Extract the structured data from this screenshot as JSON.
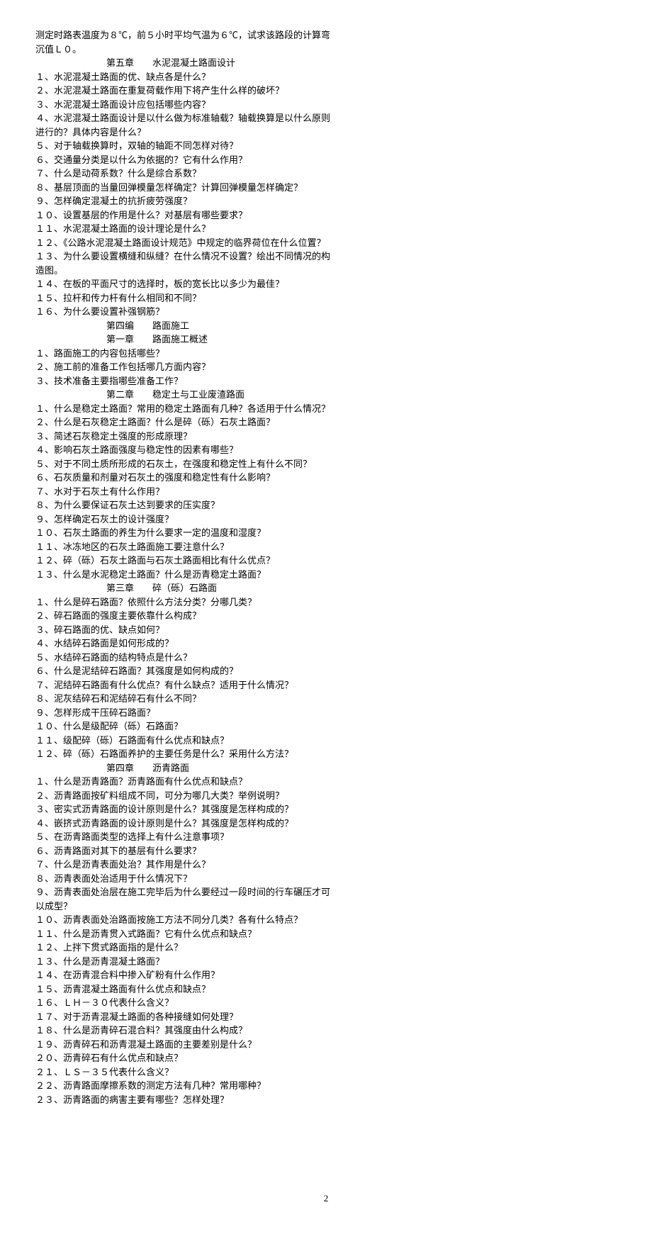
{
  "intro": "测定时路表温度为８℃，前５小时平均气温为６℃，试求该路段的计算弯沉值Ｌ０。",
  "ch5": {
    "title": "第五章　　水泥混凝土路面设计",
    "q1": "１、水泥混凝土路面的优、缺点各是什么？",
    "q2": "２、水泥混凝土路面在重复荷载作用下将产生什么样的破坏？",
    "q3": "３、水泥混凝土路面设计应包括哪些内容？",
    "q4": "４、水泥混凝土路面设计是以什么做为标准轴载？轴载换算是以什么原则进行的？具体内容是什么？",
    "q5": "５、对于轴载换算时，双轴的轴距不同怎样对待？",
    "q6": "６、交通量分类是以什么为依据的？它有什么作用？",
    "q7": "７、什么是动荷系数？什么是综合系数？",
    "q8": "８、基层顶面的当量回弹模量怎样确定？计算回弹模量怎样确定？",
    "q9": "９、怎样确定混凝土的抗折疲劳强度？",
    "q10": "１０、设置基层的作用是什么？对基层有哪些要求？",
    "q11": "１１、水泥混凝土路面的设计理论是什么？",
    "q12": "１２、《公路水泥混凝土路面设计规范》中规定的临界荷位在什么位置？",
    "q13": "１３、为什么要设置横缝和纵缝？在什么情况不设置？绘出不同情况的构造图。",
    "q14": "１４、在板的平面尺寸的选择时，板的宽长比以多少为最佳？",
    "q15": "１５、拉杆和传力杆有什么相同和不同？",
    "q16": "１６、为什么要设置补强钢筋？"
  },
  "part4": {
    "title": "第四编　　路面施工",
    "ch1": {
      "title": "第一章　　路面施工概述",
      "q1": "１、路面施工的内容包括哪些？",
      "q2": "２、施工前的准备工作包括哪几方面内容？",
      "q3": "３、技术准备主要指哪些准备工作？"
    },
    "ch2": {
      "title": "第二章　　稳定土与工业废渣路面",
      "q1": "１、什么是稳定土路面？常用的稳定土路面有几种？各适用于什么情况？",
      "q2": "２、什么是石灰稳定土路面？什么是碎（砾）石灰土路面？",
      "q3": "３、简述石灰稳定土强度的形成原理？",
      "q4": "４、影响石灰土路面强度与稳定性的因素有哪些？",
      "q5": "５、对于不同土质所形成的石灰土，在强度和稳定性上有什么不同？",
      "q6": "６、石灰质量和剂量对石灰土的强度和稳定性有什么影响？",
      "q7": "７、水对于石灰土有什么作用？",
      "q8": "８、为什么要保证石灰土达到要求的压实度？",
      "q9": "９、怎样确定石灰土的设计强度？",
      "q10": "１０、石灰土路面的养生为什么要求一定的温度和湿度？",
      "q11": "１１、冰冻地区的石灰土路面施工要注意什么？",
      "q12": "１２、碎（砾）石灰土路面与石灰土路面相比有什么优点？",
      "q13": "１３、什么是水泥稳定土路面？什么是沥青稳定土路面？"
    },
    "ch3": {
      "title": "第三章　　碎（砾）石路面",
      "q1": "１、什么是碎石路面？依照什么方法分类？分哪几类？",
      "q2": "２、碎石路面的强度主要依靠什么构成？",
      "q3": "３、碎石路面的优、缺点如何？",
      "q4": "４、水结碎石路面是如何形成的？",
      "q5": "５、水结碎石路面的结构特点是什么？",
      "q6": "６、什么是泥结碎石路面？其强度是如何构成的？",
      "q7": "７、泥结碎石路面有什么优点？有什么缺点？适用于什么情况？",
      "q8": "８、泥灰结碎石和泥结碎石有什么不同？",
      "q9": "９、怎样形成干压碎石路面？",
      "q10": "１０、什么是级配碎（砾）石路面？",
      "q11": "１１、级配碎（砾）石路面有什么优点和缺点？",
      "q12": "１２、碎（砾）石路面养护的主要任务是什么？采用什么方法？"
    },
    "ch4": {
      "title": "第四章　　沥青路面",
      "q1": "１、什么是沥青路面？沥青路面有什么优点和缺点？",
      "q2": "２、沥青路面按矿料组成不同，可分为哪几大类？举例说明？",
      "q3": "３、密实式沥青路面的设计原则是什么？其强度是怎样构成的？",
      "q4": "４、嵌挤式沥青路面的设计原则是什么？其强度是怎样构成的？",
      "q5": "５、在沥青路面类型的选择上有什么注意事项？",
      "q6": "６、沥青路面对其下的基层有什么要求？",
      "q7": "７、什么是沥青表面处治？其作用是什么？",
      "q8": "８、沥青表面处治适用于什么情况下？",
      "q9": "９、沥青表面处治层在施工完毕后为什么要经过一段时间的行车碾压才可以成型？",
      "q10": "１０、沥青表面处治路面按施工方法不同分几类？各有什么特点？",
      "q11": "１１、什么是沥青贯入式路面？它有什么优点和缺点？",
      "q12": "１２、上拌下贯式路面指的是什么？",
      "q13": "１３、什么是沥青混凝土路面？",
      "q14": "１４、在沥青混合料中掺入矿粉有什么作用？",
      "q15": "１５、沥青混凝土路面有什么优点和缺点？",
      "q16": "１６、ＬＨ－３０代表什么含义？",
      "q17": "１７、对于沥青混凝土路面的各种接缝如何处理？",
      "q18": "１８、什么是沥青碎石混合料？其强度由什么构成？",
      "q19": "１９、沥青碎石和沥青混凝土路面的主要差别是什么？",
      "q20": "２０、沥青碎石有什么优点和缺点？",
      "q21": "２１、ＬＳ－３５代表什么含义？",
      "q22": "２２、沥青路面摩擦系数的测定方法有几种？常用哪种？",
      "q23": "２３、沥青路面的病害主要有哪些？怎样处理？"
    }
  },
  "pageNumber": "2"
}
